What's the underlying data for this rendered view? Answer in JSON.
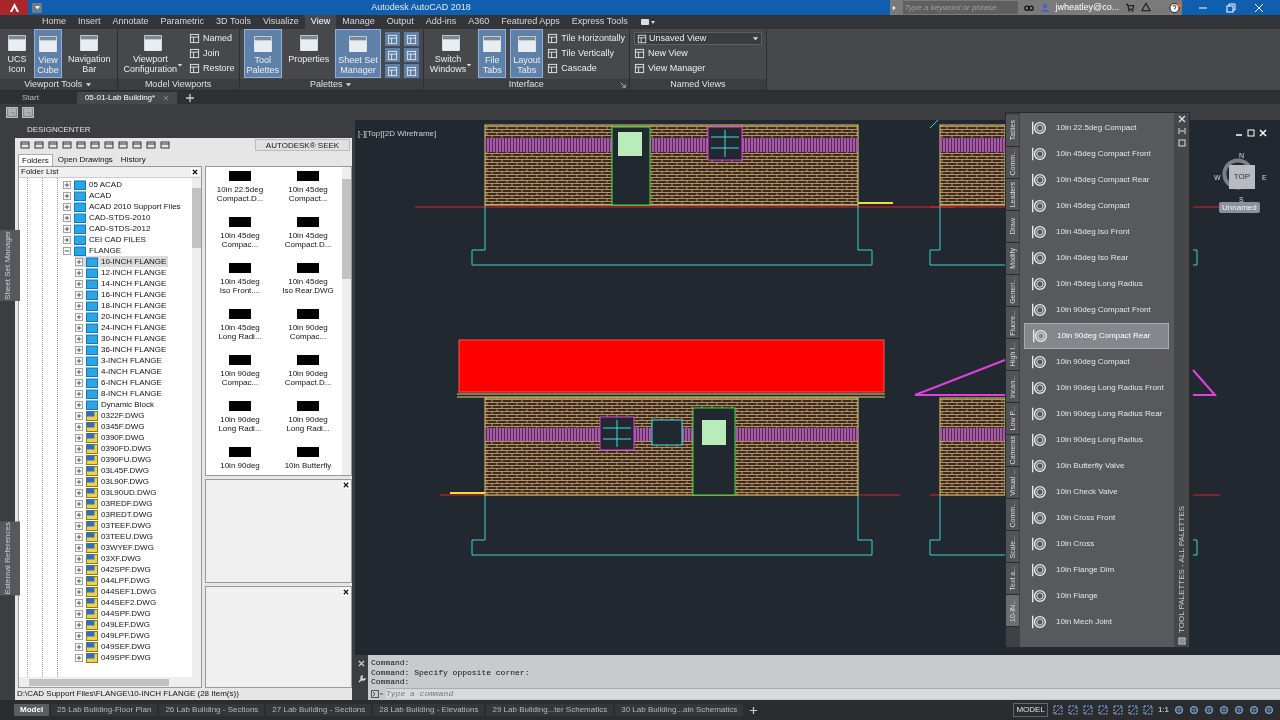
{
  "title_bar": {
    "title": "Autodesk AutoCAD 2018",
    "search": {
      "placeholder": "Type a keyword or phrase"
    },
    "user": "jwheatley@co..."
  },
  "ribbon_tabs": [
    {
      "label": "Home",
      "selected": false
    },
    {
      "label": "Insert",
      "selected": false
    },
    {
      "label": "Annotate",
      "selected": false
    },
    {
      "label": "Parametric",
      "selected": false
    },
    {
      "label": "3D Tools",
      "selected": false
    },
    {
      "label": "Visualize",
      "selected": false
    },
    {
      "label": "View",
      "selected": true
    },
    {
      "label": "Manage",
      "selected": false
    },
    {
      "label": "Output",
      "selected": false
    },
    {
      "label": "Add-ins",
      "selected": false
    },
    {
      "label": "A360",
      "selected": false
    },
    {
      "label": "Featured Apps",
      "selected": false
    },
    {
      "label": "Express Tools",
      "selected": false
    }
  ],
  "ribbon_panels": [
    {
      "title": "Viewport Tools",
      "dropdown": true,
      "items": [
        {
          "kind": "large",
          "label": "UCS\nIcon",
          "active": false
        },
        {
          "kind": "large",
          "label": "View\nCube",
          "active": true
        },
        {
          "kind": "large",
          "label": "Navigation\nBar",
          "active": false
        }
      ]
    },
    {
      "title": "Model Viewports",
      "items": [
        {
          "kind": "large",
          "label": "Viewport\nConfiguration",
          "active": false,
          "menu": true
        },
        {
          "kind": "small",
          "label": "Named"
        },
        {
          "kind": "small",
          "label": "Join"
        },
        {
          "kind": "small",
          "label": "Restore"
        }
      ]
    },
    {
      "title": "Palettes",
      "dropdown": true,
      "items": [
        {
          "kind": "large",
          "label": "Tool\nPalettes",
          "active": true
        },
        {
          "kind": "large",
          "label": "Properties",
          "active": false
        },
        {
          "kind": "large",
          "label": "Sheet Set\nManager",
          "active": true
        },
        {
          "kind": "icon",
          "active": true
        },
        {
          "kind": "icon",
          "active": true
        },
        {
          "kind": "icon",
          "active": true
        },
        {
          "kind": "icon",
          "active": true
        },
        {
          "kind": "icon",
          "active": true
        },
        {
          "kind": "icon",
          "active": true
        }
      ]
    },
    {
      "title": "Interface",
      "launcher": true,
      "items": [
        {
          "kind": "large",
          "label": "Switch\nWindows",
          "active": false,
          "menu": true
        },
        {
          "kind": "large",
          "label": "File\nTabs",
          "active": true
        },
        {
          "kind": "large",
          "label": "Layout\nTabs",
          "active": true
        },
        {
          "kind": "small",
          "label": "Tile Horizontally"
        },
        {
          "kind": "small",
          "label": "Tile Vertically"
        },
        {
          "kind": "small",
          "label": "Cascade"
        }
      ]
    },
    {
      "title": "Named Views",
      "items": [
        {
          "kind": "select",
          "label": "Unsaved View"
        },
        {
          "kind": "small",
          "label": "New View"
        },
        {
          "kind": "small",
          "label": "View Manager"
        }
      ]
    }
  ],
  "file_tabs": [
    {
      "label": "Start",
      "selected": false
    },
    {
      "label": "05-01-Lab Building*",
      "selected": true
    }
  ],
  "side_labels": [
    "Sheet Set Manager",
    "External References"
  ],
  "design_center": {
    "title": "DESIGNCENTER",
    "seek": "AUTODESK® SEEK",
    "tabs": [
      {
        "label": "Folders",
        "selected": true
      },
      {
        "label": "Open Drawings",
        "selected": false
      },
      {
        "label": "History",
        "selected": false
      }
    ],
    "folder_list_title": "Folder List",
    "folders": [
      {
        "label": "05 ACAD",
        "kind": "folder",
        "expanded": false,
        "selected": false
      },
      {
        "label": "ACAD",
        "kind": "folder",
        "expanded": false,
        "selected": false
      },
      {
        "label": "ACAD 2010 Support Files",
        "kind": "folder",
        "expanded": false,
        "selected": false
      },
      {
        "label": "CAD-STDS-2010",
        "kind": "folder",
        "expanded": false,
        "selected": false
      },
      {
        "label": "CAD-STDS-2012",
        "kind": "folder",
        "expanded": false,
        "selected": false
      },
      {
        "label": "CEI CAD FILES",
        "kind": "folder",
        "expanded": false,
        "selected": false
      },
      {
        "label": "FLANGE",
        "kind": "folder",
        "expanded": true,
        "selected": false,
        "children": [
          {
            "label": "10-INCH FLANGE",
            "kind": "folder",
            "expanded": false,
            "selected": true
          },
          {
            "label": "12-INCH FLANGE",
            "kind": "folder",
            "expanded": false,
            "selected": false
          },
          {
            "label": "14-INCH FLANGE",
            "kind": "folder",
            "expanded": false,
            "selected": false
          },
          {
            "label": "16-INCH FLANGE",
            "kind": "folder",
            "expanded": false,
            "selected": false
          },
          {
            "label": "18-INCH FLANGE",
            "kind": "folder",
            "expanded": false,
            "selected": false
          },
          {
            "label": "20-INCH FLANGE",
            "kind": "folder",
            "expanded": false,
            "selected": false
          },
          {
            "label": "24-INCH FLANGE",
            "kind": "folder",
            "expanded": false,
            "selected": false
          },
          {
            "label": "30-INCH FLANGE",
            "kind": "folder",
            "expanded": false,
            "selected": false
          },
          {
            "label": "36-INCH FLANGE",
            "kind": "folder",
            "expanded": false,
            "selected": false
          },
          {
            "label": "3-INCH FLANGE",
            "kind": "folder",
            "expanded": false,
            "selected": false
          },
          {
            "label": "4-INCH FLANGE",
            "kind": "folder",
            "expanded": false,
            "selected": false
          },
          {
            "label": "6-INCH FLANGE",
            "kind": "folder",
            "expanded": false,
            "selected": false
          },
          {
            "label": "8-INCH FLANGE",
            "kind": "folder",
            "expanded": false,
            "selected": false
          },
          {
            "label": "Dynamic Block",
            "kind": "folder",
            "expanded": false,
            "selected": false
          },
          {
            "label": "0322F.DWG",
            "kind": "drawing",
            "expanded": false,
            "selected": false
          },
          {
            "label": "0345F.DWG",
            "kind": "drawing",
            "expanded": false,
            "selected": false
          },
          {
            "label": "0390F.DWG",
            "kind": "drawing",
            "expanded": false,
            "selected": false
          },
          {
            "label": "0390FD.DWG",
            "kind": "drawing",
            "expanded": false,
            "selected": false
          },
          {
            "label": "0390FU.DWG",
            "kind": "drawing",
            "expanded": false,
            "selected": false
          },
          {
            "label": "03L45F.DWG",
            "kind": "drawing",
            "expanded": false,
            "selected": false
          },
          {
            "label": "03L90F.DWG",
            "kind": "drawing",
            "expanded": false,
            "selected": false
          },
          {
            "label": "03L90UD.DWG",
            "kind": "drawing",
            "expanded": false,
            "selected": false
          },
          {
            "label": "03REDF.DWG",
            "kind": "drawing",
            "expanded": false,
            "selected": false
          },
          {
            "label": "03REDT.DWG",
            "kind": "drawing",
            "expanded": false,
            "selected": false
          },
          {
            "label": "03TEEF.DWG",
            "kind": "drawing",
            "expanded": false,
            "selected": false
          },
          {
            "label": "03TEEU.DWG",
            "kind": "drawing",
            "expanded": false,
            "selected": false
          },
          {
            "label": "03WYEF.DWG",
            "kind": "drawing",
            "expanded": false,
            "selected": false
          },
          {
            "label": "03XF.DWG",
            "kind": "drawing",
            "expanded": false,
            "selected": false
          },
          {
            "label": "042SPF.DWG",
            "kind": "drawing",
            "expanded": false,
            "selected": false
          },
          {
            "label": "044LPF.DWG",
            "kind": "drawing",
            "expanded": false,
            "selected": false
          },
          {
            "label": "044SEF1.DWG",
            "kind": "drawing",
            "expanded": false,
            "selected": false
          },
          {
            "label": "044SEF2.DWG",
            "kind": "drawing",
            "expanded": false,
            "selected": false
          },
          {
            "label": "044SPF.DWG",
            "kind": "drawing",
            "expanded": false,
            "selected": false
          },
          {
            "label": "049LEF.DWG",
            "kind": "drawing",
            "expanded": false,
            "selected": false
          },
          {
            "label": "049LPF.DWG",
            "kind": "drawing",
            "expanded": false,
            "selected": false
          },
          {
            "label": "049SEF.DWG",
            "kind": "drawing",
            "expanded": false,
            "selected": false
          },
          {
            "label": "049SPF.DWG",
            "kind": "drawing",
            "expanded": false,
            "selected": false
          }
        ]
      }
    ],
    "items": [
      "10in 22.5deg\nCompact.D...",
      "10in 45deg\nCompact...",
      "10in 45deg\nCompac...",
      "10in 45deg\nCompact.D...",
      "10in 45deg\nIso Front....",
      "10in 45deg\nIso Rear.DWG",
      "10in 45deg\nLong Radi...",
      "10in 90deg\nCompac...",
      "10in 90deg\nCompac...",
      "10in 90deg\nCompact.D...",
      "10in 90deg\nLong Radi...",
      "10in 90deg\nLong Radi...",
      "10in 90deg",
      "10in Butterfly"
    ],
    "status": "D:\\CAD Support Files\\FLANGE\\10-INCH FLANGE (28 Item(s))"
  },
  "viewport": {
    "label": "[-][Top][2D Wireframe]",
    "view_cube": {
      "north": "N",
      "east": "E",
      "south": "S",
      "west": "W",
      "top": "TOP",
      "ucs": "Unnamed"
    }
  },
  "tool_palette": {
    "title": "TOOL PALETTES - ALL PALETTES",
    "side_tabs": [
      {
        "label": "Tables",
        "selected": false
      },
      {
        "label": "Comm...",
        "selected": false
      },
      {
        "label": "Leaders",
        "selected": false
      },
      {
        "label": "Draw",
        "selected": false
      },
      {
        "label": "Modify",
        "selected": false
      },
      {
        "label": "Generi...",
        "selected": false
      },
      {
        "label": "Fluore...",
        "selected": false
      },
      {
        "label": "High I...",
        "selected": false
      },
      {
        "label": "Incan...",
        "selected": false
      },
      {
        "label": "Low P...",
        "selected": false
      },
      {
        "label": "Cameras",
        "selected": false
      },
      {
        "label": "Visual ...",
        "selected": false
      },
      {
        "label": "Comm...",
        "selected": false
      },
      {
        "label": "Scale...",
        "selected": false
      },
      {
        "label": "Text a...",
        "selected": false
      },
      {
        "label": "10-IN...",
        "selected": true
      }
    ],
    "items": [
      {
        "label": "10in 22.5deg Compact",
        "selected": false
      },
      {
        "label": "10in 45deg Compact Front",
        "selected": false
      },
      {
        "label": "10in 45deg Compact Rear",
        "selected": false
      },
      {
        "label": "10in 45deg Compact",
        "selected": false
      },
      {
        "label": "10in 45deg Iso Front",
        "selected": false
      },
      {
        "label": "10in 45deg Iso Rear",
        "selected": false
      },
      {
        "label": "10in 45deg Long Radius",
        "selected": false
      },
      {
        "label": "10in 90deg Compact Front",
        "selected": false
      },
      {
        "label": "10in 90deg Compact Rear",
        "selected": true
      },
      {
        "label": "10in 90deg Compact",
        "selected": false
      },
      {
        "label": "10in 90deg Long Radius Front",
        "selected": false
      },
      {
        "label": "10in 90deg Long Radius Rear",
        "selected": false
      },
      {
        "label": "10in 90deg Long Radius",
        "selected": false
      },
      {
        "label": "10in Butterfly Valve",
        "selected": false
      },
      {
        "label": "10in Check Valve",
        "selected": false
      },
      {
        "label": "10in Cross Front",
        "selected": false
      },
      {
        "label": "10in Cross",
        "selected": false
      },
      {
        "label": "10in Flange Dim",
        "selected": false
      },
      {
        "label": "10in Flange",
        "selected": false
      },
      {
        "label": "10in Mech Joint",
        "selected": false
      }
    ]
  },
  "command_line": {
    "history": [
      "Command:",
      "Command: Specify opposite corner:",
      "Command:"
    ],
    "placeholder": "Type a command"
  },
  "layout_tabs": [
    {
      "label": "Model",
      "selected": true
    },
    {
      "label": "25 Lab Building-Floor Plan",
      "selected": false
    },
    {
      "label": "26 Lab Building - Sections",
      "selected": false
    },
    {
      "label": "27 Lab Building - Sections",
      "selected": false
    },
    {
      "label": "28 Lab Building - Elevations",
      "selected": false
    },
    {
      "label": "29 Lab Building...ter Schematics",
      "selected": false
    },
    {
      "label": "30 Lab Building...ain Schematics",
      "selected": false
    }
  ],
  "status_bar": {
    "space": "MODEL",
    "scale": "1:1"
  }
}
